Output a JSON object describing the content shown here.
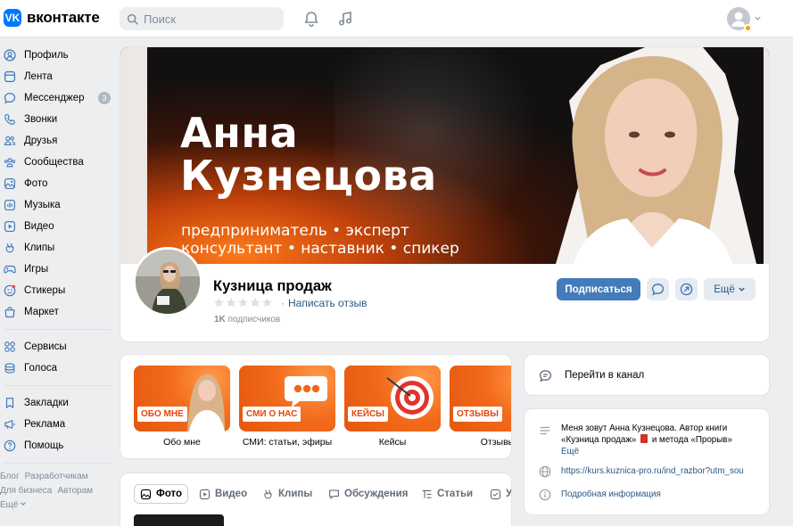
{
  "header": {
    "logo_text": "вконтакте",
    "search_placeholder": "Поиск"
  },
  "icons": {
    "bell": "bell-icon",
    "music": "music-note-icon",
    "avatar_chevron": "chevron-down-icon"
  },
  "sidebar": {
    "items": [
      {
        "label": "Профиль",
        "icon": "user-icon"
      },
      {
        "label": "Лента",
        "icon": "news-icon"
      },
      {
        "label": "Мессенджер",
        "icon": "message-icon",
        "badge": "3"
      },
      {
        "label": "Звонки",
        "icon": "phone-icon"
      },
      {
        "label": "Друзья",
        "icon": "friends-icon"
      },
      {
        "label": "Сообщества",
        "icon": "communities-icon"
      },
      {
        "label": "Фото",
        "icon": "photo-icon"
      },
      {
        "label": "Музыка",
        "icon": "music-icon"
      },
      {
        "label": "Видео",
        "icon": "video-icon"
      },
      {
        "label": "Клипы",
        "icon": "clips-icon"
      },
      {
        "label": "Игры",
        "icon": "gamepad-icon"
      },
      {
        "label": "Стикеры",
        "icon": "sticker-icon"
      },
      {
        "label": "Маркет",
        "icon": "market-icon"
      }
    ],
    "items2": [
      {
        "label": "Сервисы",
        "icon": "services-icon"
      },
      {
        "label": "Голоса",
        "icon": "coins-icon"
      }
    ],
    "items3": [
      {
        "label": "Закладки",
        "icon": "bookmark-icon"
      },
      {
        "label": "Реклама",
        "icon": "megaphone-icon"
      },
      {
        "label": "Помощь",
        "icon": "help-icon"
      }
    ],
    "footer": {
      "blog": "Блог",
      "developers": "Разработчикам",
      "business": "Для бизнеса",
      "authors": "Авторам",
      "more": "Ещё"
    }
  },
  "cover": {
    "name_line1": "Анна",
    "name_line2": "Кузнецова",
    "sub_line1": "предприниматель • эксперт",
    "sub_line2": "консультант • наставник • спикер"
  },
  "profile": {
    "title": "Кузница продаж",
    "review_link": "Написать отзыв",
    "subscribers_count": "1K",
    "subscribers_label": "подписчиков",
    "subscribe_button": "Подписаться",
    "more_button": "Ещё"
  },
  "stories": [
    {
      "label": "ОБО МНЕ",
      "caption": "Обо мне"
    },
    {
      "label": "СМИ О НАС",
      "caption": "СМИ: статьи, эфиры"
    },
    {
      "label": "КЕЙСЫ",
      "caption": "Кейсы"
    },
    {
      "label": "ОТЗЫВЫ",
      "caption": "Отзывы"
    }
  ],
  "tabs": [
    {
      "label": "Фото",
      "icon": "photo-icon",
      "active": true
    },
    {
      "label": "Видео",
      "icon": "video-icon"
    },
    {
      "label": "Клипы",
      "icon": "clips-icon"
    },
    {
      "label": "Обсуждения",
      "icon": "discussion-icon"
    },
    {
      "label": "Статьи",
      "icon": "articles-icon"
    },
    {
      "label": "У",
      "icon": "check-icon"
    }
  ],
  "channel": {
    "label": "Перейти в канал"
  },
  "info": {
    "description_part1": "Меня зовут Анна Кузнецова. Автор книги «Кузница продаж»",
    "description_part2": "и метода «Прорыв»",
    "more": "Ещё",
    "link": "https://kurs.kuznica-pro.ru/ind_razbor?utm_sou",
    "details": "Подробная информация"
  },
  "colors": {
    "accent": "#447bba",
    "link": "#2a5885",
    "brand": "#0077ff",
    "cover_orange": "#f26a1b"
  }
}
